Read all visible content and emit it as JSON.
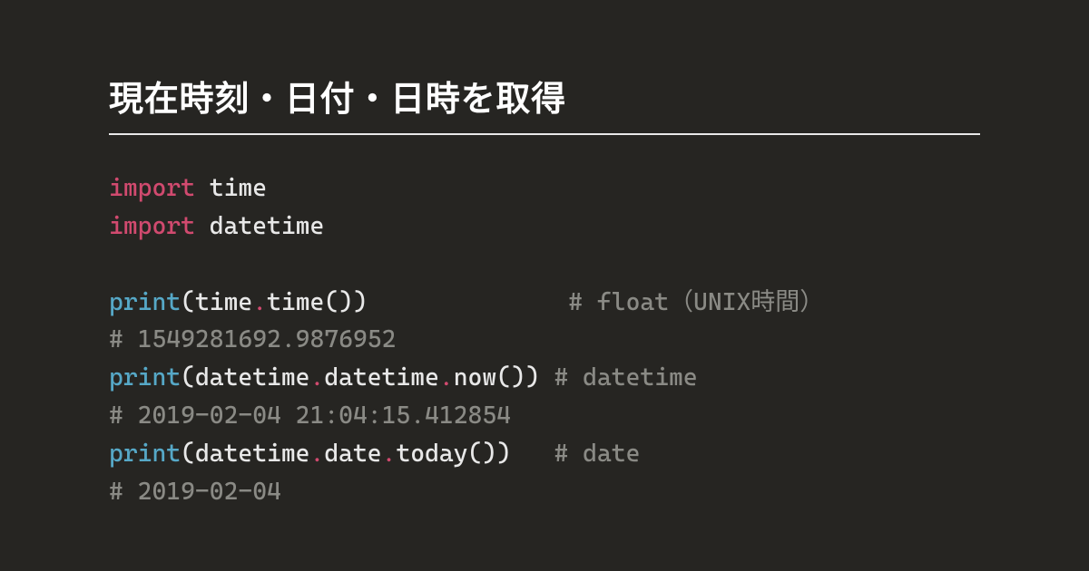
{
  "title": "現在時刻・日付・日時を取得",
  "code": {
    "kw_import": "import",
    "mod_time": "time",
    "mod_datetime": "datetime",
    "fn_print": "print",
    "dot": ".",
    "lp": "(",
    "rp": ")",
    "unit_empty": "()",
    "id_time": "time",
    "id_datetime": "datetime",
    "id_date": "date",
    "id_now": "now",
    "id_today": "today",
    "c1_pad": "              ",
    "c1": "# float（UNIX時間）",
    "c2": "# 1549281692.9876952",
    "c3_pad": " ",
    "c3": "# datetime",
    "c4": "# 2019-02-04 21:04:15.412854",
    "c5_pad": "   ",
    "c5": "# date",
    "c6": "# 2019-02-04"
  }
}
